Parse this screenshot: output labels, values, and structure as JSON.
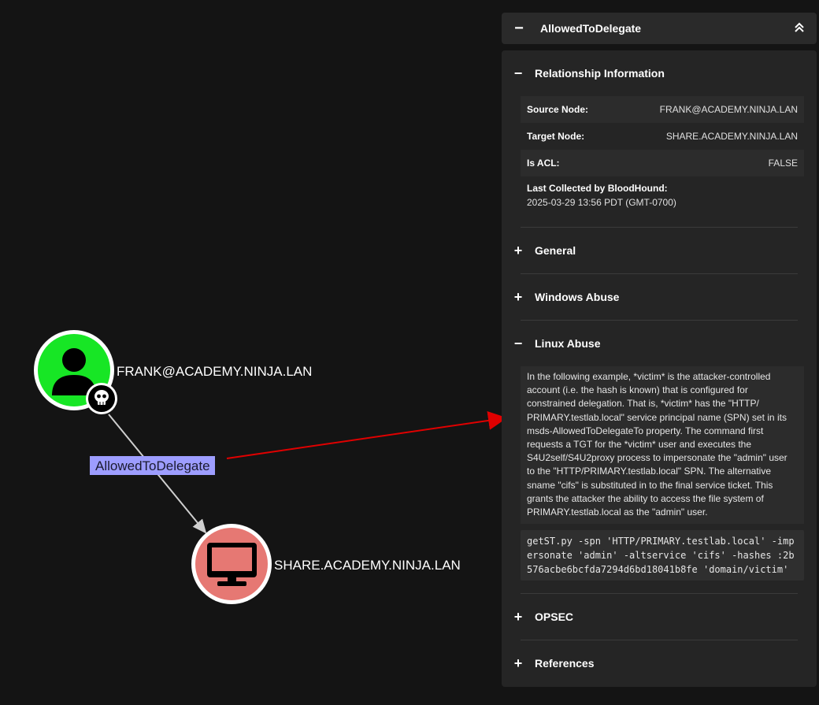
{
  "graph": {
    "source_node": {
      "label": "FRANK@ACADEMY.NINJA.LAN",
      "icon": "user-icon",
      "badge_icon": "skull-icon",
      "color": "#17e625"
    },
    "target_node": {
      "label": "SHARE.ACADEMY.NINJA.LAN",
      "icon": "computer-icon",
      "color": "#e67873"
    },
    "edge": {
      "label": "AllowedToDelegate",
      "label_bg": "#9d9dff"
    },
    "annotation_arrow_color": "#e00000"
  },
  "panel": {
    "header": {
      "title": "AllowedToDelegate",
      "minus": "−",
      "collapse_icon": "double-chevron-up-icon"
    },
    "relationship": {
      "title": "Relationship Information",
      "rows": [
        {
          "key": "Source Node:",
          "value": "FRANK@ACADEMY.NINJA.LAN"
        },
        {
          "key": "Target Node:",
          "value": "SHARE.ACADEMY.NINJA.LAN"
        },
        {
          "key": "Is ACL:",
          "value": "FALSE"
        },
        {
          "key": "Last Collected by BloodHound:",
          "value": "2025-03-29 13:56 PDT (GMT-0700)"
        }
      ]
    },
    "sections": {
      "general": "General",
      "windows_abuse": "Windows Abuse",
      "linux_abuse": "Linux Abuse",
      "opsec": "OPSEC",
      "references": "References"
    },
    "linux_abuse_text": "In the following example, *victim* is the attacker-controlled account (i.e. the hash is known) that is configured for constrained delegation. That is, *victim* has the \"HTTP/ PRIMARY.testlab.local\" service principal name (SPN) set in its msds-AllowedToDelegateTo property. The command first requests a TGT for the *victim* user and executes the S4U2self/S4U2proxy process to impersonate the \"admin\" user to the \"HTTP/PRIMARY.testlab.local\" SPN. The alternative sname \"cifs\" is substituted in to the final service ticket. This grants the attacker the ability to access the file system of PRIMARY.testlab.local as the \"admin\" user.",
    "linux_abuse_code": "getST.py -spn 'HTTP/PRIMARY.testlab.local' -impersonate 'admin' -altservice 'cifs' -hashes :2b576acbe6bcfda7294d6bd18041b8fe 'domain/victim'"
  }
}
